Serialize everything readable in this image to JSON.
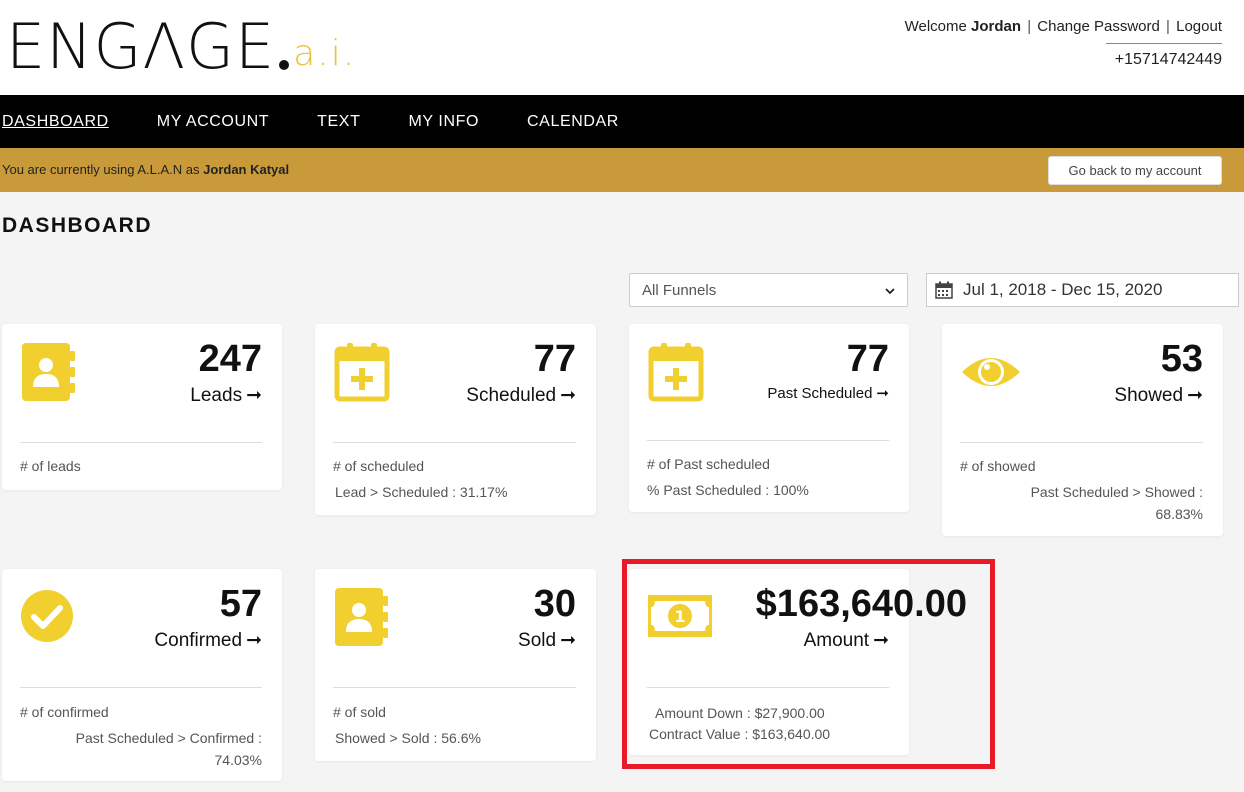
{
  "header": {
    "logo_main": "ENGΛGE",
    "logo_ai": "a.i.",
    "welcome_prefix": "Welcome",
    "user_name": "Jordan",
    "change_password": "Change Password",
    "logout": "Logout",
    "phone": "+15714742449"
  },
  "nav": {
    "items": [
      "DASHBOARD",
      "MY ACCOUNT",
      "TEXT",
      "MY INFO",
      "CALENDAR"
    ]
  },
  "impersonation": {
    "prefix": "You are currently using A.L.A.N as",
    "name": "Jordan Katyal",
    "button": "Go back to my account"
  },
  "page_title": "DASHBOARD",
  "filters": {
    "funnel_selected": "All Funnels",
    "date_range": "Jul 1, 2018 - Dec 15, 2020"
  },
  "cards": {
    "leads": {
      "value": "247",
      "label": "Leads",
      "line1": "# of leads",
      "line2": ""
    },
    "scheduled": {
      "value": "77",
      "label": "Scheduled",
      "line1": "# of scheduled",
      "line2": "Lead > Scheduled : 31.17%"
    },
    "past_scheduled": {
      "value": "77",
      "label": "Past Scheduled",
      "line1": "# of Past scheduled",
      "line2": "% Past Scheduled : 100%"
    },
    "showed": {
      "value": "53",
      "label": "Showed",
      "line1": "# of showed",
      "line2a": "Past Scheduled > Showed :",
      "line2b": "68.83%"
    },
    "confirmed": {
      "value": "57",
      "label": "Confirmed",
      "line1": "# of confirmed",
      "line2a": "Past Scheduled > Confirmed :",
      "line2b": "74.03%"
    },
    "sold": {
      "value": "30",
      "label": "Sold",
      "line1": "# of sold",
      "line2": "Showed > Sold : 56.6%"
    },
    "amount": {
      "value": "$163,640.00",
      "label": "Amount",
      "line1": "Amount Down : $27,900.00",
      "line2": "Contract Value : $163,640.00"
    }
  },
  "colors": {
    "accent_yellow": "#f0cf2f",
    "impersonation_bar": "#c99a3a",
    "highlight_border": "#e81a27",
    "nav_background": "#000000"
  }
}
